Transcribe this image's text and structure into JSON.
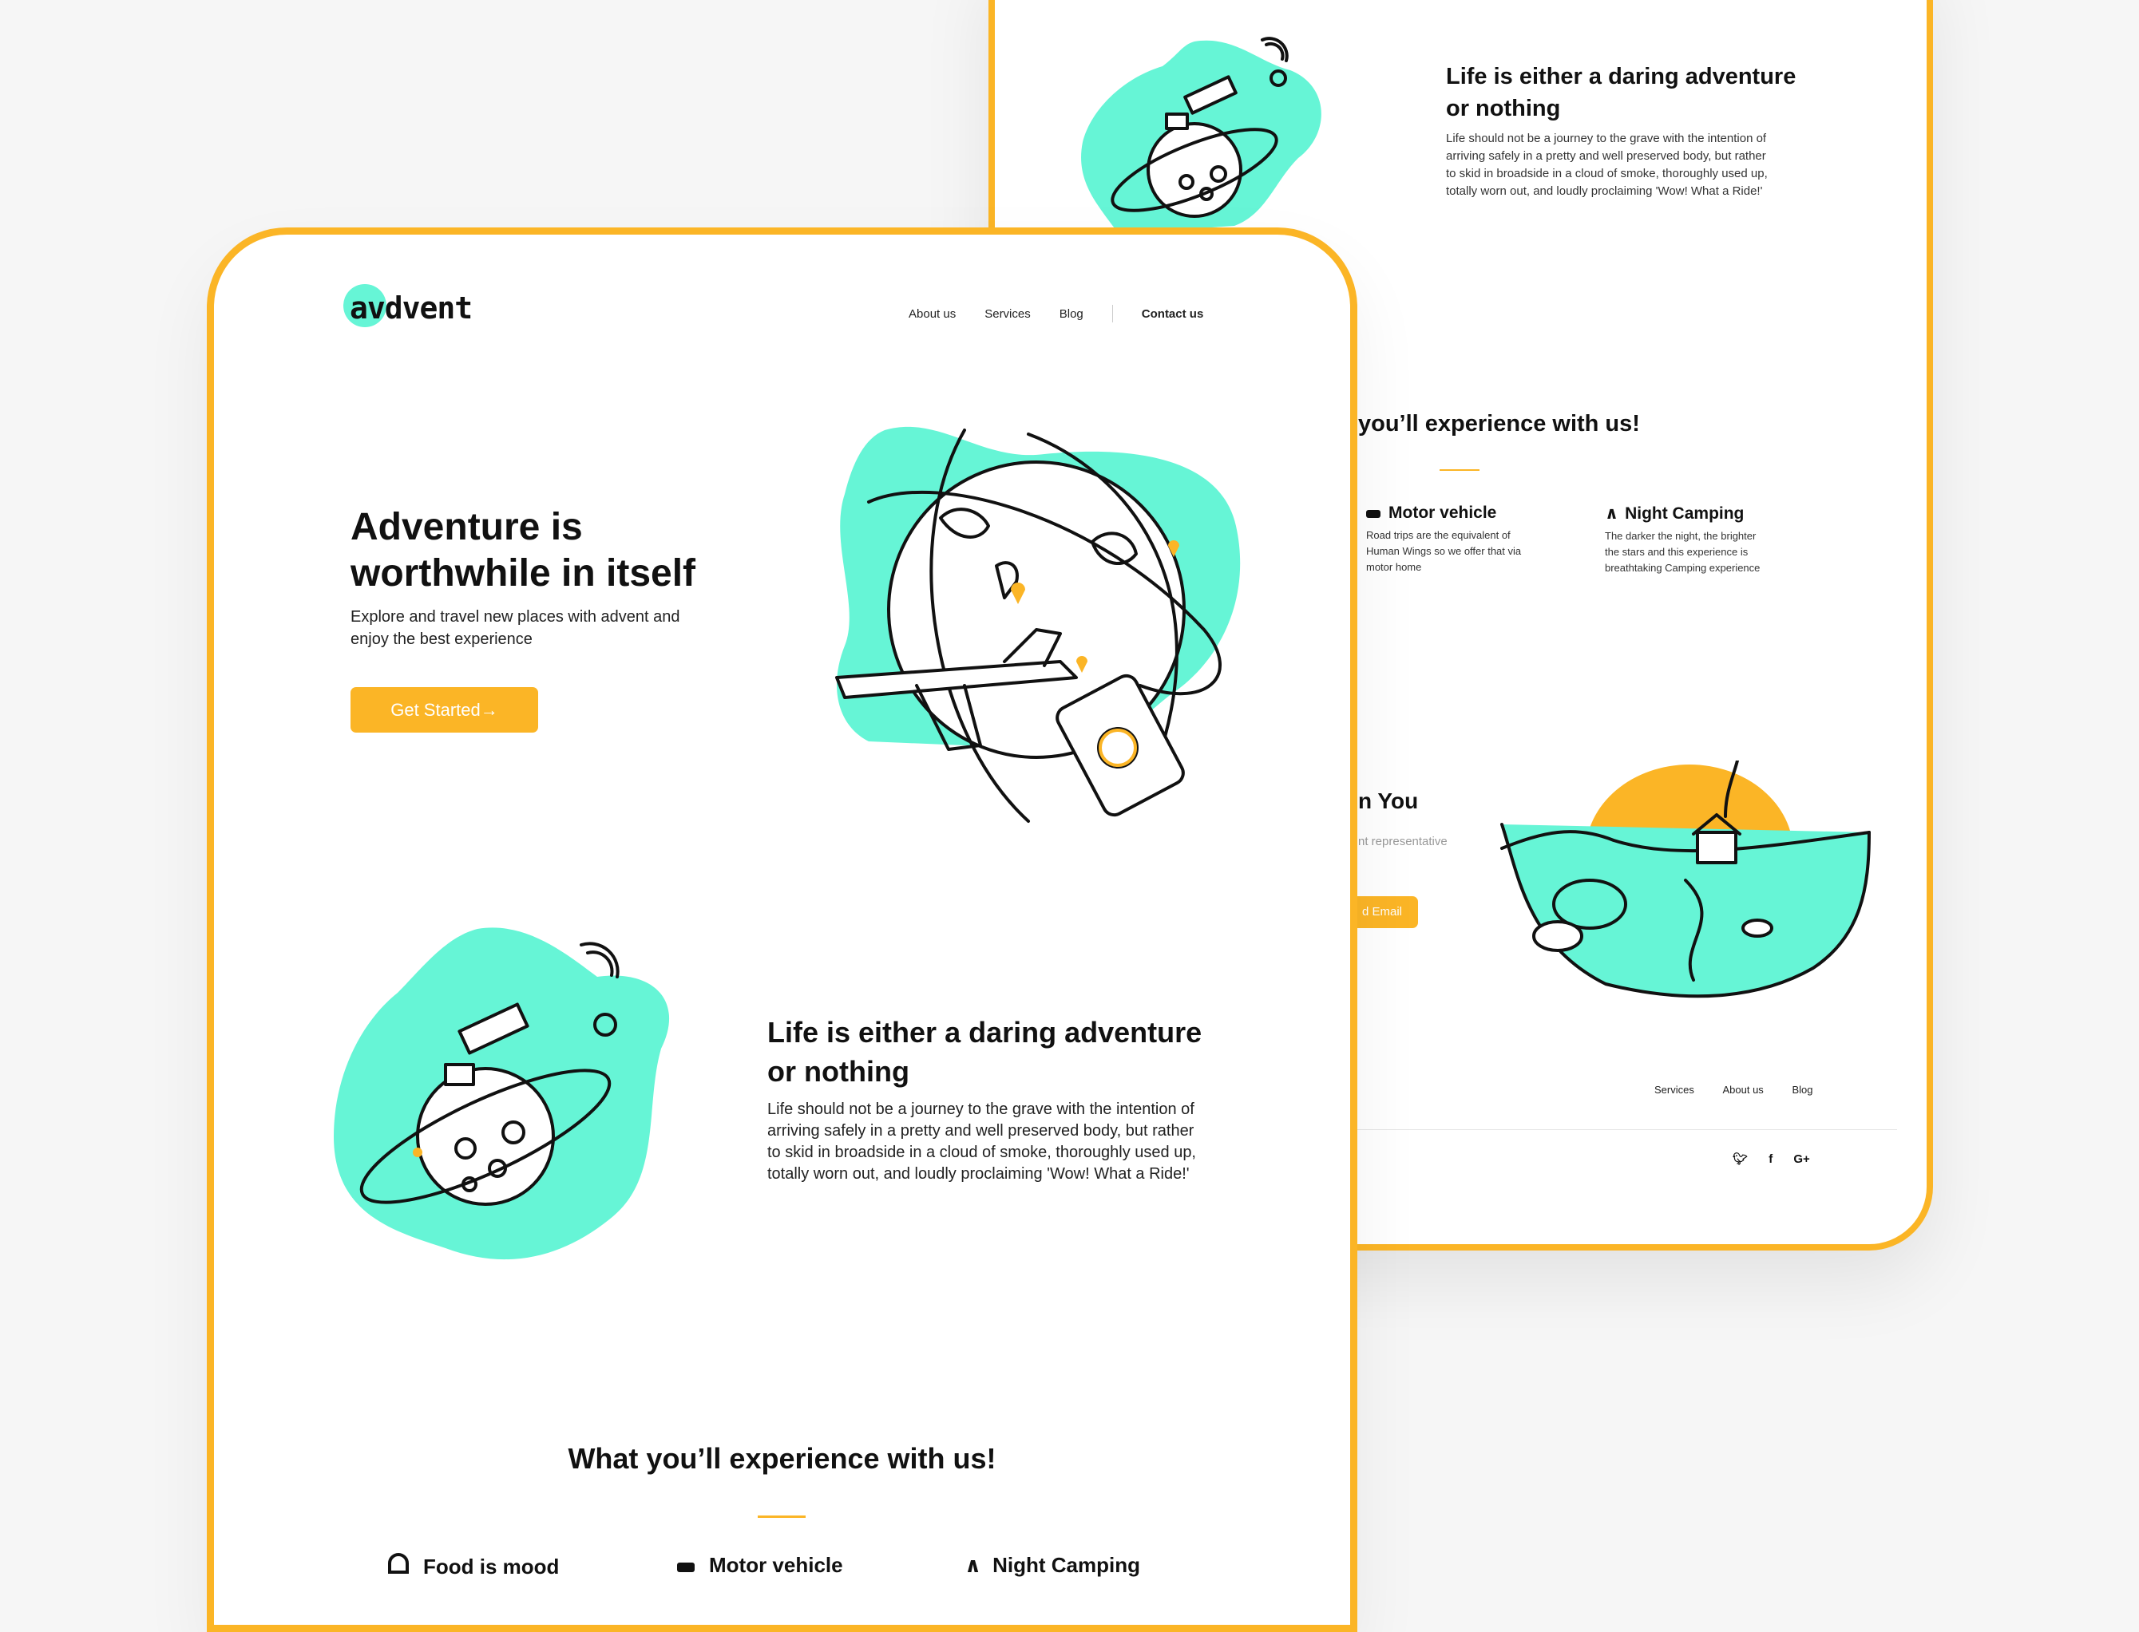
{
  "colors": {
    "accent": "#fbb526",
    "mint": "#66f5d6",
    "ink": "#111111",
    "background": "#f6f6f6"
  },
  "brand": {
    "logo": "avdvent"
  },
  "nav": {
    "about": "About us",
    "services": "Services",
    "blog": "Blog",
    "contact": "Contact us"
  },
  "hero": {
    "title_line1": "Adventure is",
    "title_line2": "worthwhile in itself",
    "subtitle_line1": "Explore and travel new places with advent and",
    "subtitle_line2": "enjoy the best experience",
    "cta": "Get Started→"
  },
  "about": {
    "title_line1": "Life is either a daring adventure",
    "title_line2": "or nothing",
    "body_line1": "Life should not be a journey to the grave with the intention of",
    "body_line2": "arriving safely in a pretty and well preserved body, but rather",
    "body_line3": "to skid in broadside in a cloud of smoke, thoroughly used up,",
    "body_line4": "totally worn out, and loudly proclaiming 'Wow! What a Ride!'"
  },
  "experience": {
    "title": "What you’ll experience with us!",
    "title_partial": "you’ll experience with us!",
    "features": [
      {
        "icon": "food-icon",
        "title": "Food is mood"
      },
      {
        "icon": "car-icon",
        "title": "Motor vehicle",
        "body_line1": "Road trips are the equivalent of",
        "body_line2": "Human Wings so we offer that via",
        "body_line3": "motor home"
      },
      {
        "icon": "tent-icon",
        "title": "Night Camping",
        "body_line1": "The darker the night, the brighter",
        "body_line2": "the stars and this experience is",
        "body_line3": "breathtaking Camping experience"
      }
    ]
  },
  "contact": {
    "title_partial": "n You",
    "text_partial": "nt representative",
    "button_partial": "d Email"
  },
  "footer": {
    "services": "Services",
    "about": "About us",
    "blog": "Blog",
    "social": [
      "twitter-icon",
      "facebook-icon",
      "google-plus-icon"
    ]
  }
}
